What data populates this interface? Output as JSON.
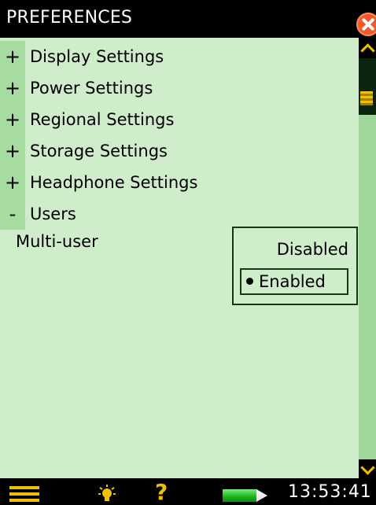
{
  "title": "PREFERENCES",
  "tree": [
    {
      "toggle": "+",
      "label": "Display Settings"
    },
    {
      "toggle": "+",
      "label": "Power Settings"
    },
    {
      "toggle": "+",
      "label": "Regional Settings"
    },
    {
      "toggle": "+",
      "label": "Storage Settings"
    },
    {
      "toggle": "+",
      "label": "Headphone Settings"
    },
    {
      "toggle": "-",
      "label": "Users"
    }
  ],
  "users": {
    "setting_label": "Multi-user",
    "options": [
      "Disabled",
      "Enabled"
    ],
    "selected": "Enabled"
  },
  "status_bar": {
    "time": "13:53:41",
    "icons": [
      "menu-icon",
      "backlight-bulb-icon",
      "help-icon",
      "battery-icon"
    ]
  },
  "colors": {
    "accent": "#f0c000",
    "panel_bg": "#cfeccb",
    "toggle_bg": "#a6dc9f",
    "close_button": "#ef5a2b"
  }
}
